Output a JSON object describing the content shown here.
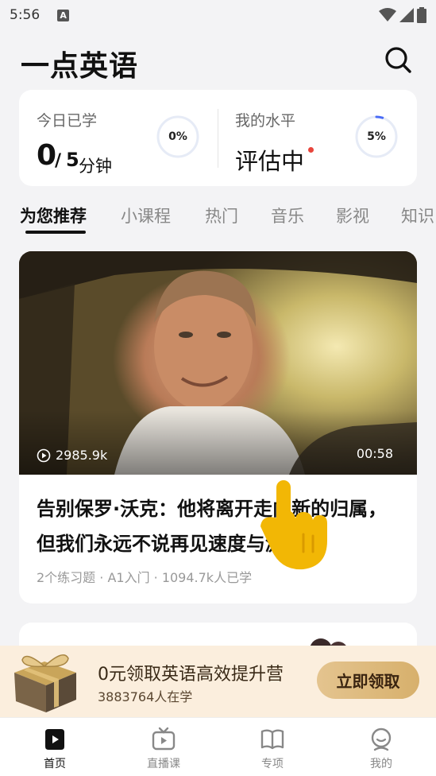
{
  "status": {
    "time": "5:56",
    "notif": "A"
  },
  "app": {
    "title": "一点英语"
  },
  "stats": {
    "today_label": "今日已学",
    "today_value": "0",
    "today_sep": "/",
    "today_goal": "5",
    "today_unit": "分钟",
    "today_percent": "0%",
    "today_progress": 0,
    "level_label": "我的水平",
    "level_value": "评估中",
    "level_percent": "5%",
    "level_progress": 0.05
  },
  "tabs": [
    {
      "label": "为您推荐"
    },
    {
      "label": "小课程"
    },
    {
      "label": "热门"
    },
    {
      "label": "音乐"
    },
    {
      "label": "影视"
    },
    {
      "label": "知识"
    }
  ],
  "video": {
    "views": "2985.9k",
    "duration": "00:58",
    "title": "告别保罗·沃克：他将离开走向新的归属，但我们永远不说再见速度与激…",
    "meta": "2个练习题 · A1入门 · 1094.7k人已学"
  },
  "promo": {
    "title": "0元领取英语高效提升营",
    "subtitle": "3883764人在学",
    "button": "立即领取"
  },
  "nav": [
    {
      "label": "首页"
    },
    {
      "label": "直播课"
    },
    {
      "label": "专项"
    },
    {
      "label": "我的"
    }
  ],
  "colors": {
    "accent": "#111111",
    "ring_progress": "#4a6cf7",
    "promo_bg": "#fbeedd",
    "button": "#d7b06c"
  }
}
